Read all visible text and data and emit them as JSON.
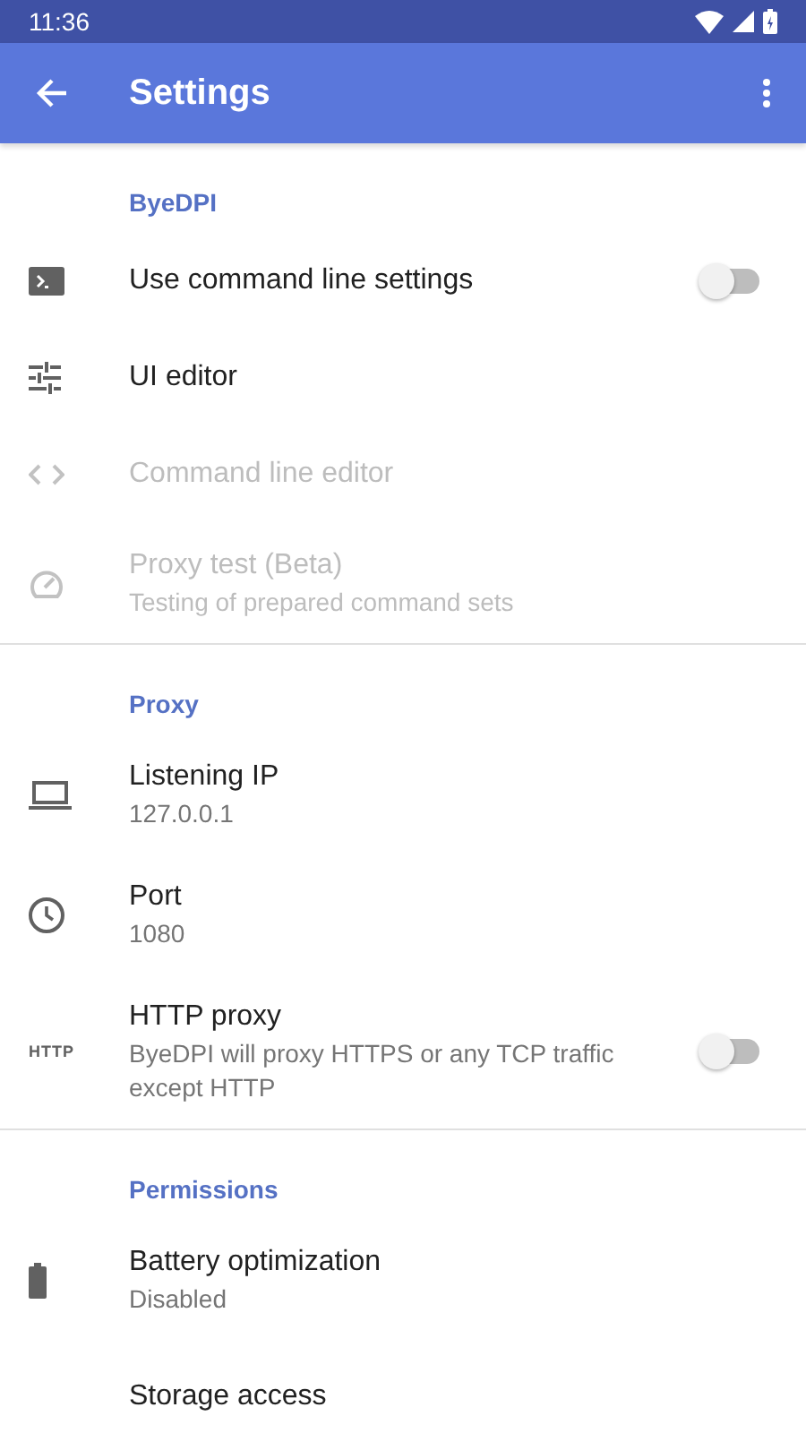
{
  "status_bar": {
    "time": "11:36"
  },
  "app_bar": {
    "title": "Settings"
  },
  "sections": [
    {
      "title": "ByeDPI",
      "items": [
        {
          "kind": "toggle",
          "title": "Use command line settings",
          "disabled": false,
          "on": false
        },
        {
          "kind": "plain",
          "title": "UI editor",
          "disabled": false
        },
        {
          "kind": "plain",
          "title": "Command line editor",
          "disabled": true
        },
        {
          "kind": "plain",
          "title": "Proxy test (Beta)",
          "summary": "Testing of prepared command sets",
          "disabled": true
        }
      ]
    },
    {
      "title": "Proxy",
      "items": [
        {
          "kind": "plain",
          "title": "Listening IP",
          "summary": "127.0.0.1",
          "disabled": false
        },
        {
          "kind": "plain",
          "title": "Port",
          "summary": "1080",
          "disabled": false
        },
        {
          "kind": "toggle",
          "icon_text": "HTTP",
          "title": "HTTP proxy",
          "summary": "ByeDPI will proxy HTTPS or any TCP traffic except HTTP",
          "disabled": false,
          "on": false
        }
      ]
    },
    {
      "title": "Permissions",
      "items": [
        {
          "kind": "plain",
          "title": "Battery optimization",
          "summary": "Disabled",
          "disabled": false
        },
        {
          "kind": "plain",
          "title": "Storage access",
          "disabled": false
        }
      ]
    }
  ]
}
